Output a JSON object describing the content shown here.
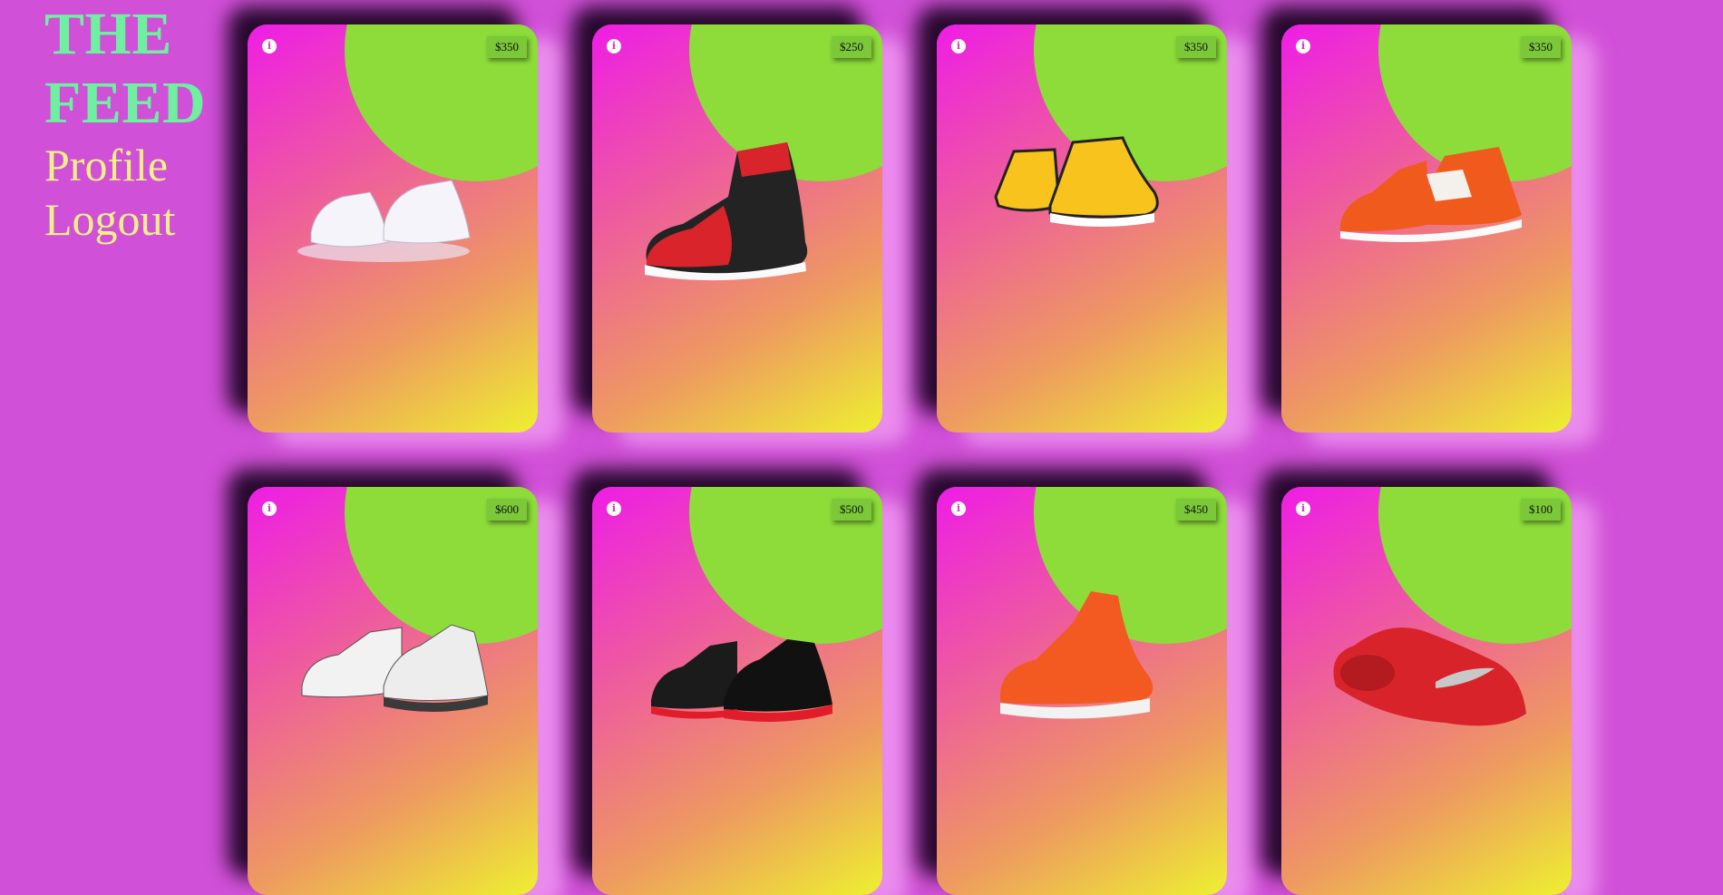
{
  "brand": {
    "line1": "THE",
    "line2": "FEED"
  },
  "nav": {
    "profile": "Profile",
    "logout": "Logout"
  },
  "cards": [
    {
      "price": "$350",
      "shoe": "white"
    },
    {
      "price": "$250",
      "shoe": "red-black"
    },
    {
      "price": "$350",
      "shoe": "yellow-black"
    },
    {
      "price": "$350",
      "shoe": "orange-white"
    },
    {
      "price": "$600",
      "shoe": "white-cement"
    },
    {
      "price": "$500",
      "shoe": "black-red"
    },
    {
      "price": "$450",
      "shoe": "orange"
    },
    {
      "price": "$100",
      "shoe": "red-runner"
    }
  ],
  "colors": {
    "background": "#d150d8",
    "brand": "#6ef0a0",
    "nav": "#f3f08a",
    "disc": "#8ddc3a"
  }
}
